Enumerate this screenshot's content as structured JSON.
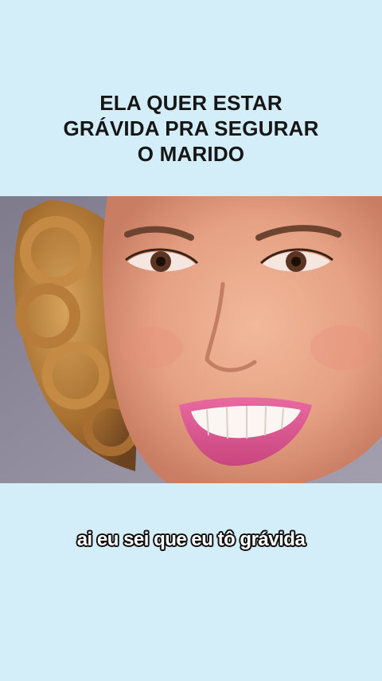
{
  "post": {
    "title_lines": [
      "ELA QUER ESTAR",
      "GRÁVIDA PRA SEGURAR",
      "O MARIDO"
    ],
    "caption": "ai eu sei que eu tô grávida"
  },
  "video": {
    "subject": "smiling-woman-closeup"
  },
  "colors": {
    "background": "#d3eef9",
    "title_text": "#161616",
    "caption_text": "#ffffff",
    "caption_outline": "#111111"
  }
}
